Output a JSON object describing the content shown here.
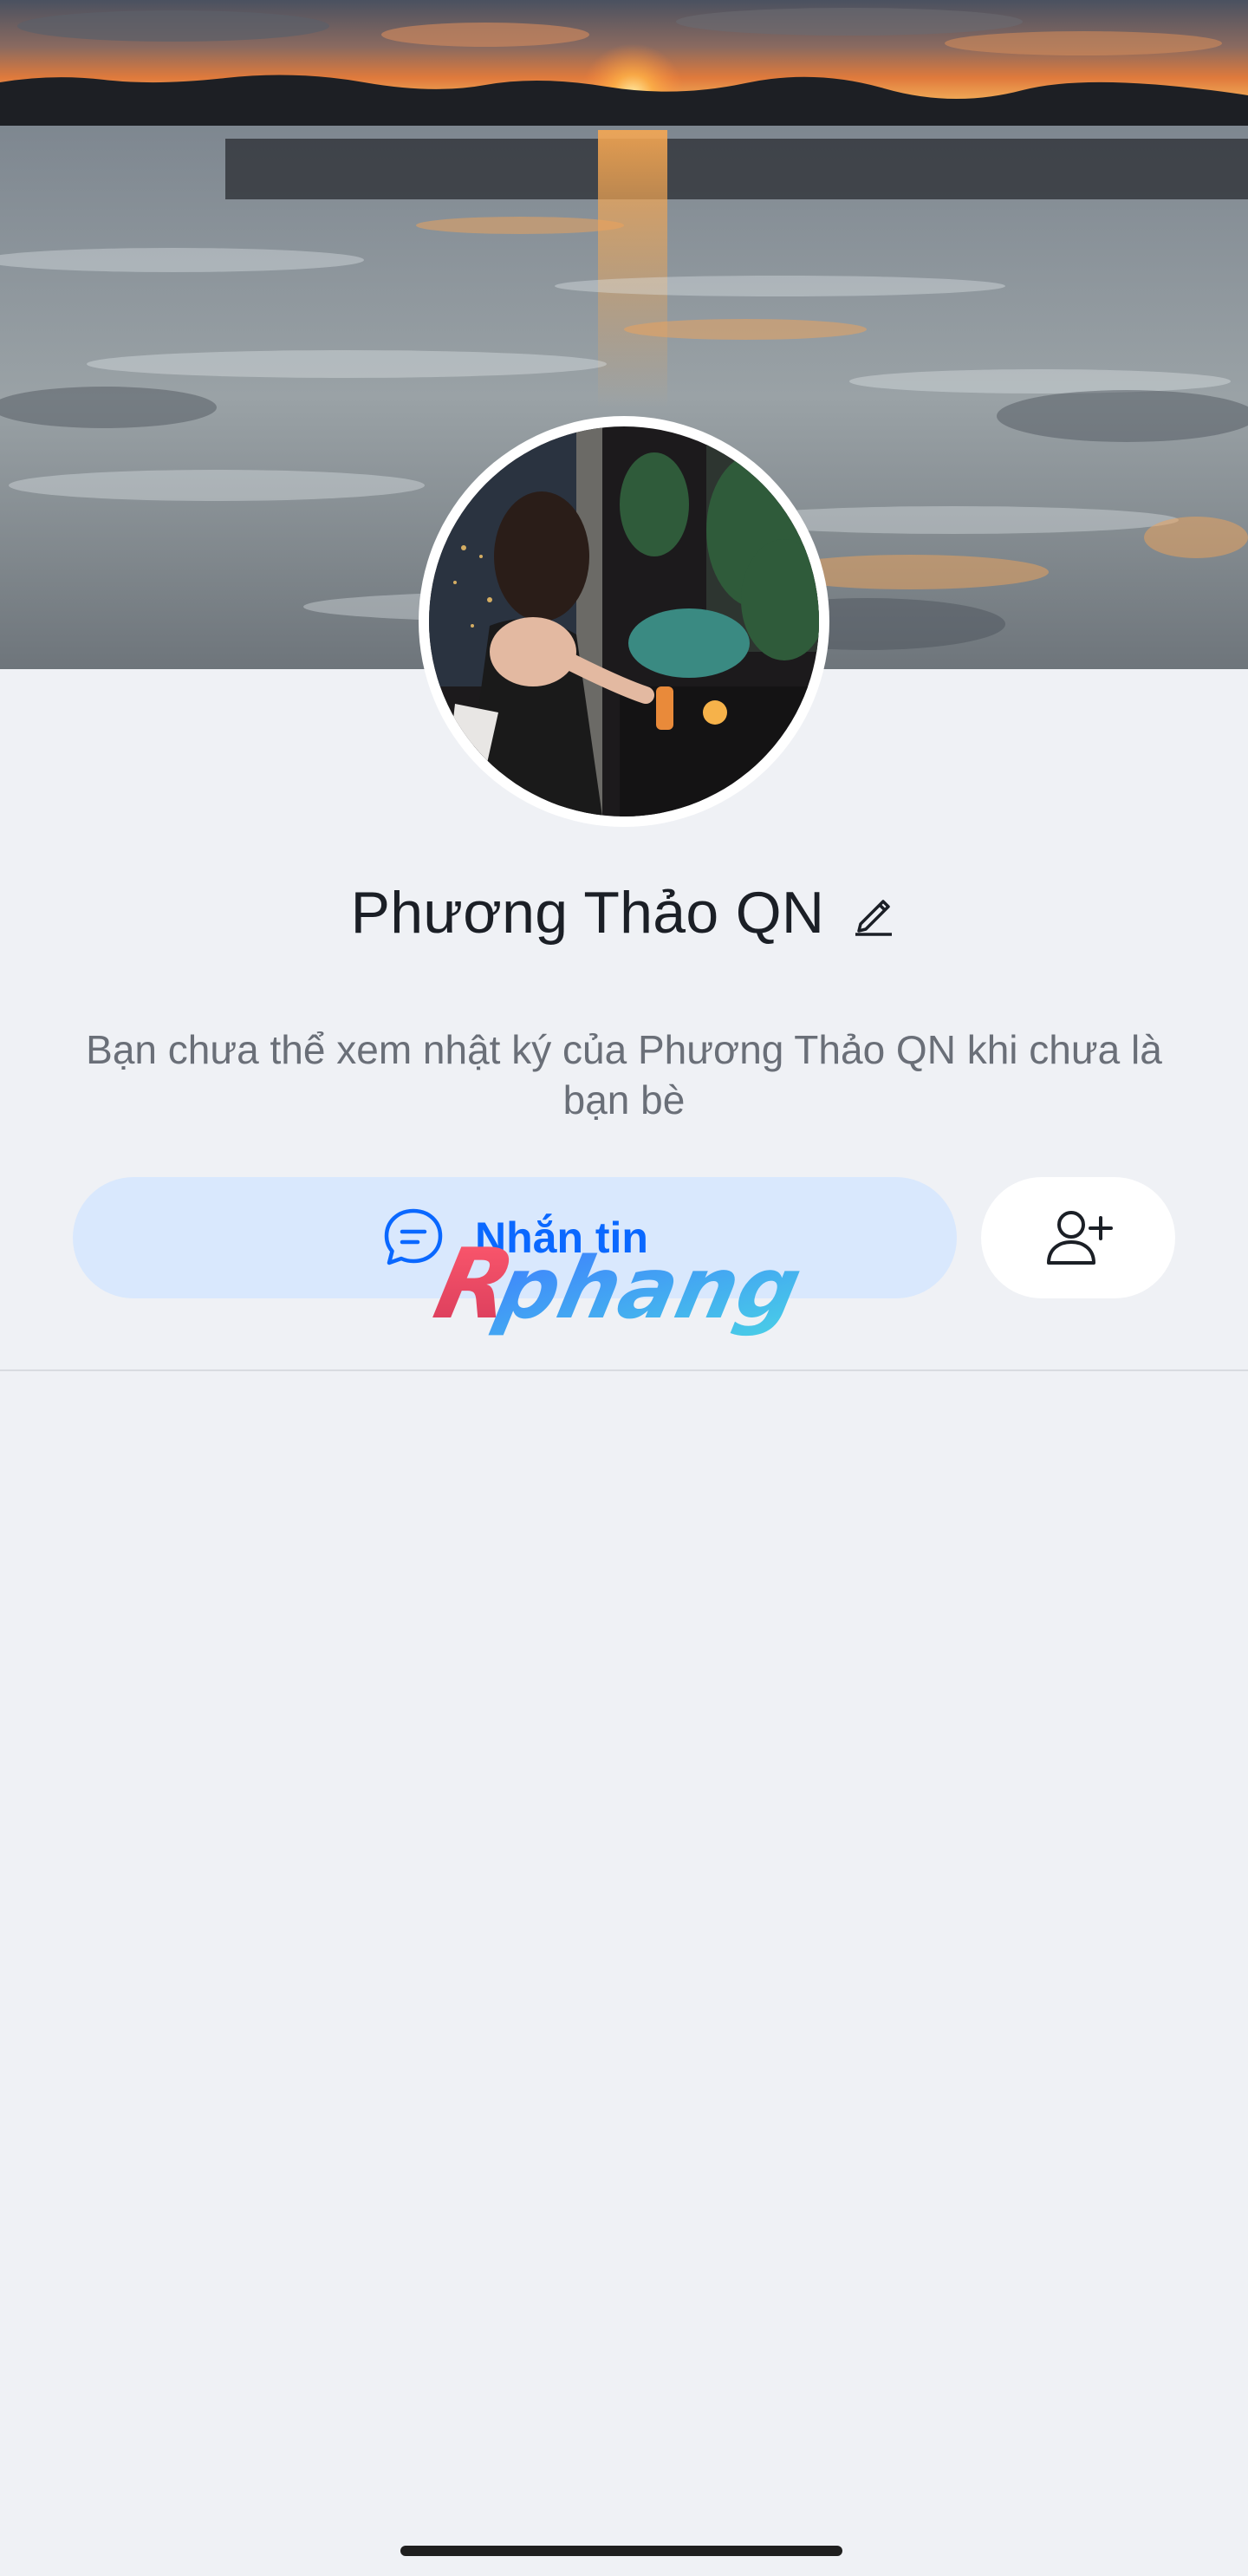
{
  "profile": {
    "display_name": "Phương Thảo QN",
    "privacy_note": "Bạn chưa thể xem nhật ký của Phương Thảo QN khi chưa là bạn bè"
  },
  "actions": {
    "message_label": "Nhắn tin",
    "message_icon": "chat-bubble-icon",
    "add_friend_icon": "add-user-icon",
    "edit_icon": "pencil-icon"
  },
  "watermark": {
    "text": "Rphang"
  },
  "colors": {
    "background": "#eff1f5",
    "accent": "#0a68ff",
    "message_button_bg": "#d9e8fd",
    "text_primary": "#1b1f26",
    "text_secondary": "#6a6f78"
  }
}
